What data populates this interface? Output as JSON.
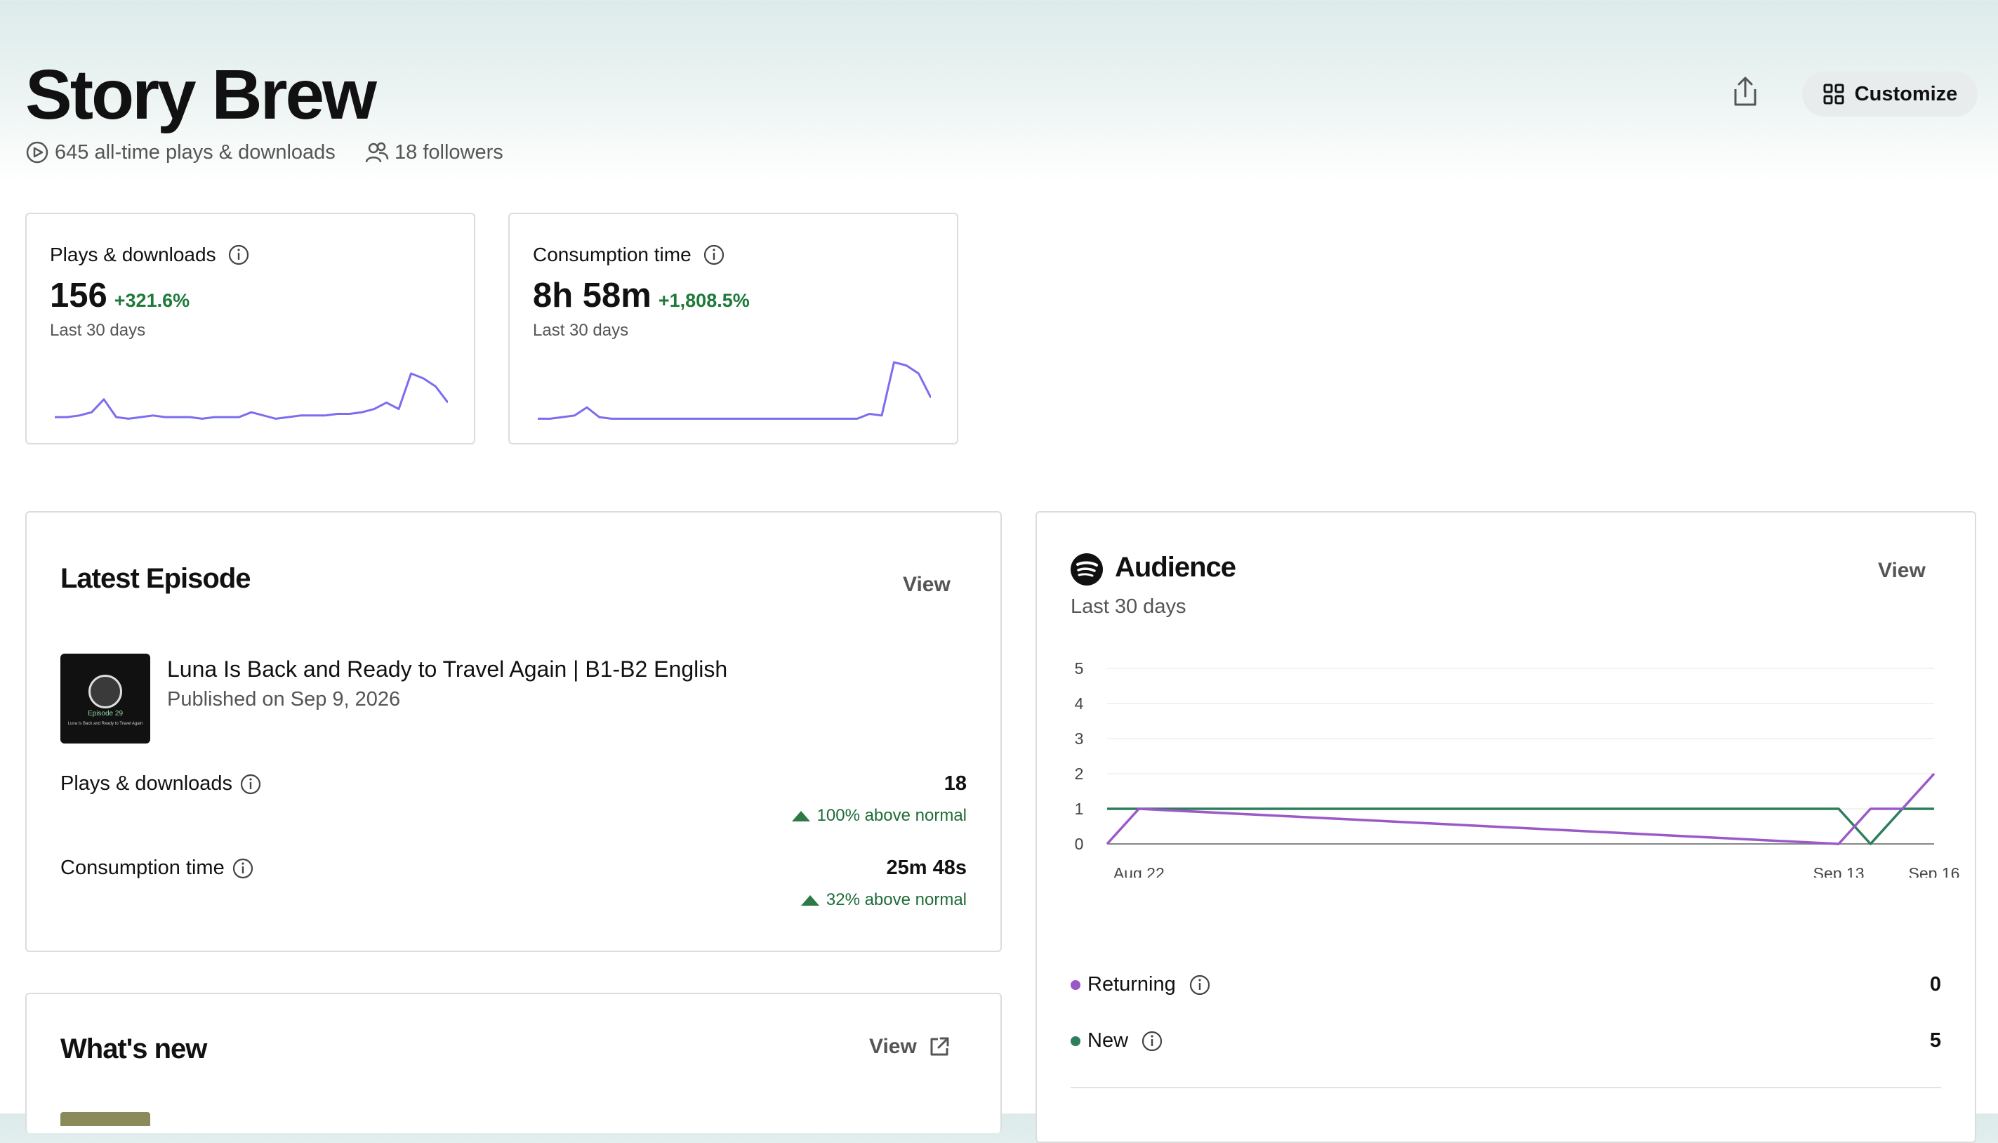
{
  "header": {
    "title": "Story Brew",
    "plays_meta": "645 all-time plays & downloads",
    "followers_meta": "18 followers",
    "customize_label": "Customize"
  },
  "stats": [
    {
      "label": "Plays & downloads",
      "value": "156",
      "delta": "+321.6%",
      "period": "Last 30 days",
      "sparkline": [
        3,
        3,
        4,
        6,
        14,
        3,
        2,
        3,
        4,
        3,
        3,
        3,
        2,
        3,
        3,
        3,
        6,
        4,
        2,
        3,
        4,
        4,
        4,
        5,
        5,
        6,
        8,
        12,
        8,
        30,
        27,
        22,
        12
      ]
    },
    {
      "label": "Consumption time",
      "value": "8h 58m",
      "delta": "+1,808.5%",
      "period": "Last 30 days",
      "sparkline": [
        2,
        2,
        3,
        4,
        9,
        3,
        2,
        2,
        2,
        2,
        2,
        2,
        2,
        2,
        2,
        2,
        2,
        2,
        2,
        2,
        2,
        2,
        2,
        2,
        2,
        2,
        2,
        5,
        4,
        37,
        35,
        30,
        15
      ]
    }
  ],
  "latest_episode": {
    "title": "Latest Episode",
    "view_label": "View",
    "episode_title": "Luna Is Back and Ready to Travel Again | B1-B2 English",
    "published": "Published on Sep 9, 2026",
    "thumb_episode": "Episode 29",
    "thumb_caption": "Luna Is Back and Ready to Travel Again",
    "rows": [
      {
        "label": "Plays & downloads",
        "value": "18",
        "trend": "100% above normal"
      },
      {
        "label": "Consumption time",
        "value": "25m 48s",
        "trend": "32% above normal"
      }
    ]
  },
  "whats_new": {
    "title": "What's new",
    "view_label": "View"
  },
  "audience": {
    "title": "Audience",
    "period": "Last 30 days",
    "view_label": "View",
    "legend": [
      {
        "label": "Returning",
        "value": "0",
        "color": "#9b59c8"
      },
      {
        "label": "New",
        "value": "5",
        "color": "#2e7d5b"
      }
    ]
  },
  "chart_data": {
    "type": "line",
    "x_tick_labels": [
      "Aug 22",
      "Sep 13",
      "Sep 16"
    ],
    "y_ticks": [
      0,
      1,
      2,
      3,
      4,
      5
    ],
    "ylim": [
      0,
      5
    ],
    "grid": true,
    "series": [
      {
        "name": "Returning",
        "color": "#9b59c8",
        "points": [
          [
            "Aug 21",
            0
          ],
          [
            "Aug 22",
            1
          ],
          [
            "Sep 13",
            0
          ],
          [
            "Sep 14",
            1
          ],
          [
            "Sep 15",
            1
          ],
          [
            "Sep 16",
            2
          ]
        ]
      },
      {
        "name": "New",
        "color": "#2e7d5b",
        "points": [
          [
            "Aug 21",
            1
          ],
          [
            "Aug 22",
            1
          ],
          [
            "Sep 13",
            1
          ],
          [
            "Sep 14",
            0
          ],
          [
            "Sep 15",
            1
          ],
          [
            "Sep 16",
            1
          ]
        ]
      }
    ]
  }
}
